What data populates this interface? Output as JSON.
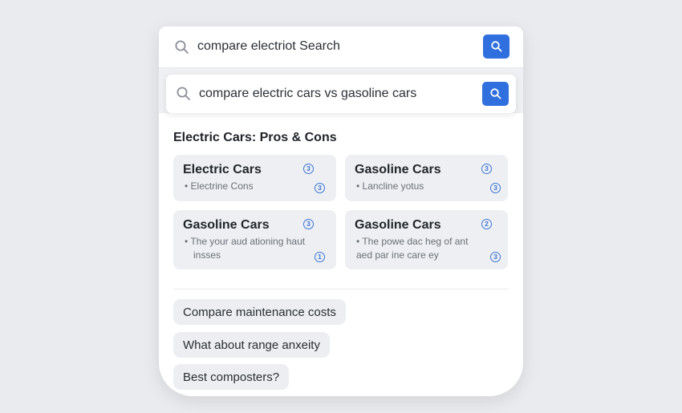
{
  "top_search": {
    "query": "compare electriot Search",
    "icon": "search-icon",
    "button_icon": "search-icon"
  },
  "suggestion": {
    "query": "compare electric cars vs gasoline cars",
    "icon": "search-icon",
    "button_icon": "search-icon"
  },
  "results": {
    "title": "Electric Cars: Pros & Cons",
    "tiles": [
      {
        "title": "Electric Cars",
        "body": "• Electrine Cons",
        "badge_top": "3",
        "badge_bottom": "3"
      },
      {
        "title": "Gasoline Cars",
        "body": "• Lancline yotus",
        "badge_top": "3",
        "badge_bottom": "3"
      },
      {
        "title": "Gasoline Cars",
        "body": "• The your aud ationing haut",
        "body2": "insses",
        "badge_top": "3",
        "badge_bottom": "1"
      },
      {
        "title": "Gasoline Cars",
        "body": "• The powe dac heg of ant",
        "body2": "aed par ine care ey",
        "badge_top": "2",
        "badge_bottom": "3"
      }
    ]
  },
  "followups": [
    "Compare maintenance costs",
    "What about range anxeity",
    "Best composters?"
  ],
  "colors": {
    "accent": "#2f6fde",
    "background": "#e9ebee",
    "tile": "#edeff2"
  }
}
